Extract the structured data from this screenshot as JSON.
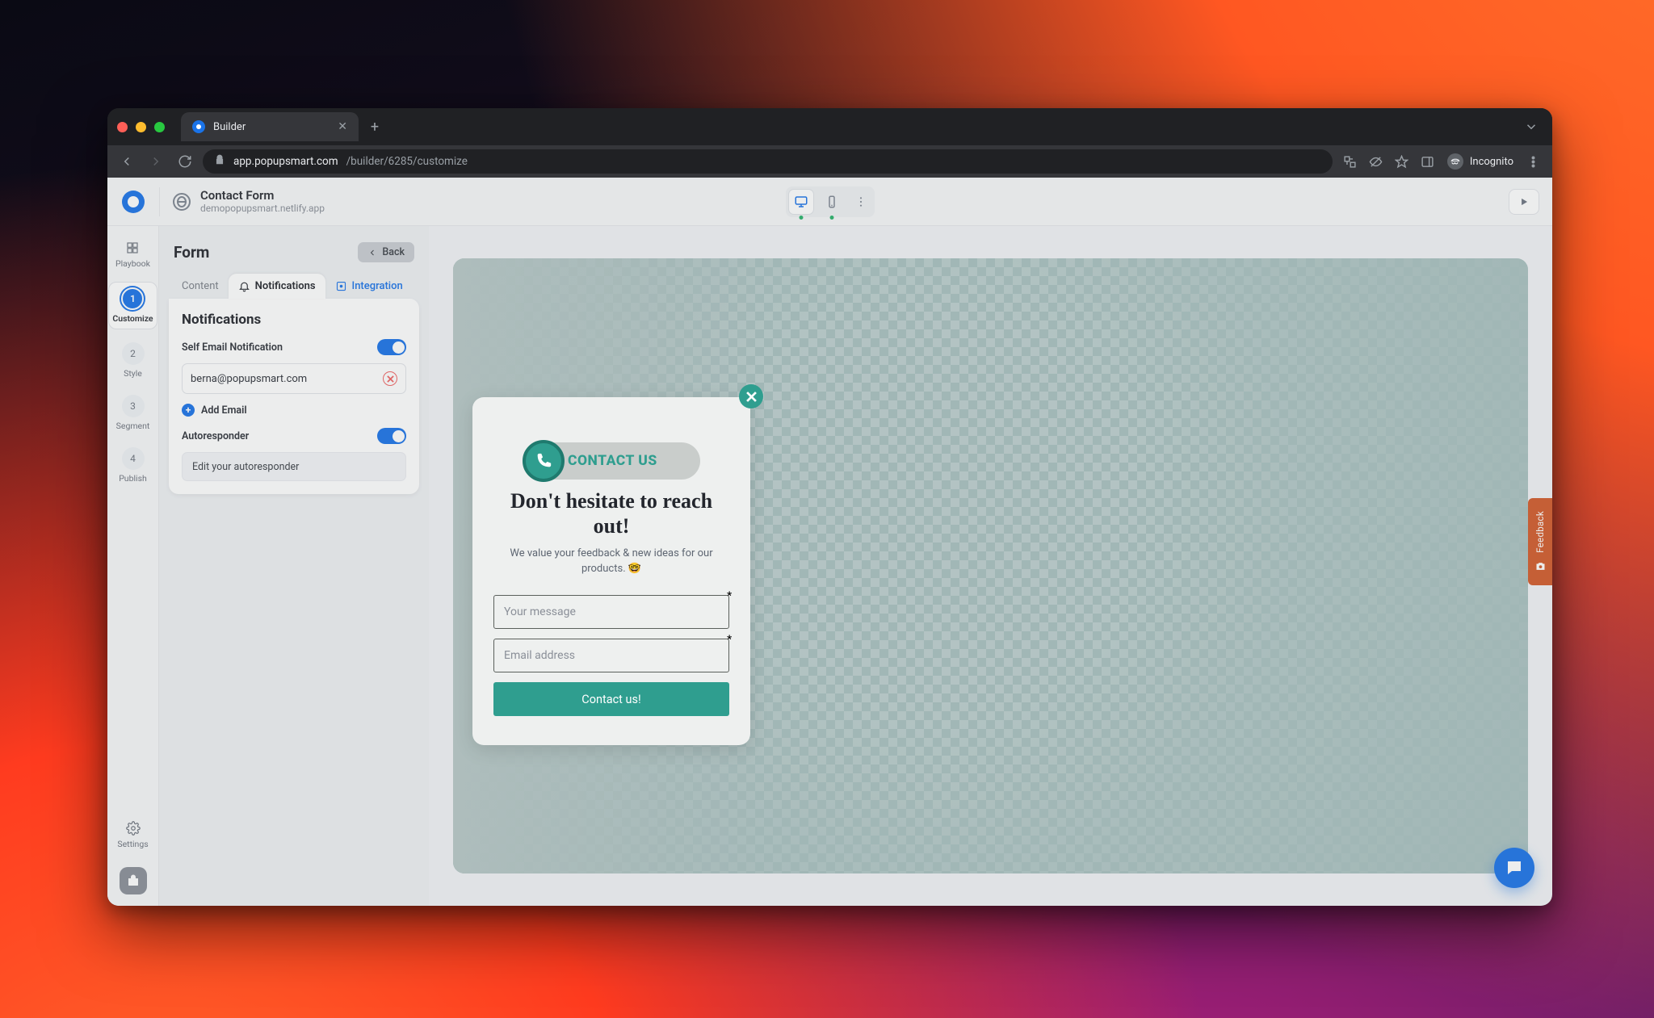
{
  "browser": {
    "tab_title": "Builder",
    "url_host": "app.popupsmart.com",
    "url_path": "/builder/6285/customize",
    "incognito_label": "Incognito"
  },
  "appbar": {
    "title": "Contact Form",
    "subtitle": "demopopupsmart.netlify.app"
  },
  "rail": {
    "items": [
      {
        "label": "Playbook"
      },
      {
        "num": "1",
        "label": "Customize"
      },
      {
        "num": "2",
        "label": "Style"
      },
      {
        "num": "3",
        "label": "Segment"
      },
      {
        "num": "4",
        "label": "Publish"
      }
    ],
    "settings": "Settings"
  },
  "sidepanel": {
    "heading": "Form",
    "back": "Back",
    "tabs": {
      "content": "Content",
      "notifications": "Notifications",
      "integration": "Integration"
    },
    "card": {
      "title": "Notifications",
      "self_label": "Self Email Notification",
      "email": "berna@popupsmart.com",
      "add_email": "Add Email",
      "autoresponder": "Autoresponder",
      "edit_auto": "Edit your autoresponder"
    }
  },
  "popup": {
    "badge": "CONTACT US",
    "heading": "Don't hesitate to reach out!",
    "body": "We value your feedback & new ideas for our products. 🤓",
    "msg_placeholder": "Your message",
    "email_placeholder": "Email address",
    "cta": "Contact us!"
  },
  "feedback": "Feedback"
}
